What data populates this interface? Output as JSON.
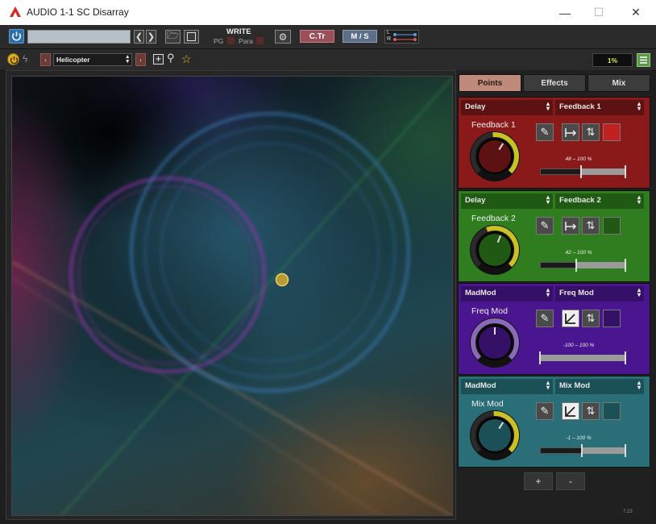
{
  "window": {
    "title": "AUDIO 1-1 SC Disarray",
    "minimize": "—",
    "maximize": "☐",
    "close": "✕"
  },
  "host_toolbar": {
    "power_icon": "power-icon",
    "preset_field": "",
    "write_label": "WRITE",
    "pg_label": "PG",
    "para_label": "Para",
    "ctr_label": "C.Tr",
    "ms_label": "M / S",
    "l_label": "L",
    "r_label": "R"
  },
  "plugin_toolbar": {
    "preset_name": "Helicopter",
    "cpu_meter": "1%"
  },
  "tabs": [
    "Points",
    "Effects",
    "Mix"
  ],
  "slots": [
    {
      "source": "Delay",
      "target": "Feedback 1",
      "knob_label": "Feedback 1",
      "range": "48 – 100 %",
      "knob_value": 0.62,
      "range_min": 0.48,
      "range_max": 1.0,
      "color": "#8a1a1a",
      "dark": "#5c1212",
      "knob_fill": "#c9c126"
    },
    {
      "source": "Delay",
      "target": "Feedback 2",
      "knob_label": "Feedback 2",
      "range": "42 – 100 %",
      "knob_value": 0.58,
      "range_min": 0.42,
      "range_max": 1.0,
      "color": "#2f7d1f",
      "dark": "#1f5914",
      "knob_fill": "#c9c126"
    },
    {
      "source": "MadMod",
      "target": "Freq Mod",
      "knob_label": "Freq Mod",
      "range": "-100 – 100 %",
      "knob_value": 0.5,
      "range_min": 0.0,
      "range_max": 1.0,
      "color": "#4a1690",
      "dark": "#341066",
      "knob_fill": "#8a6ab8"
    },
    {
      "source": "MadMod",
      "target": "Mix Mod",
      "knob_label": "Mix Mod",
      "range": "-1 – 100 %",
      "knob_value": 0.62,
      "range_min": 0.49,
      "range_max": 1.0,
      "color": "#2a6f78",
      "dark": "#1c5057",
      "knob_fill": "#c9c126"
    }
  ],
  "buttons": {
    "add": "+",
    "remove": "-"
  },
  "version": "7.23",
  "colors": {
    "accent": "#c0a13a",
    "title_logo": "#d42a1f"
  }
}
